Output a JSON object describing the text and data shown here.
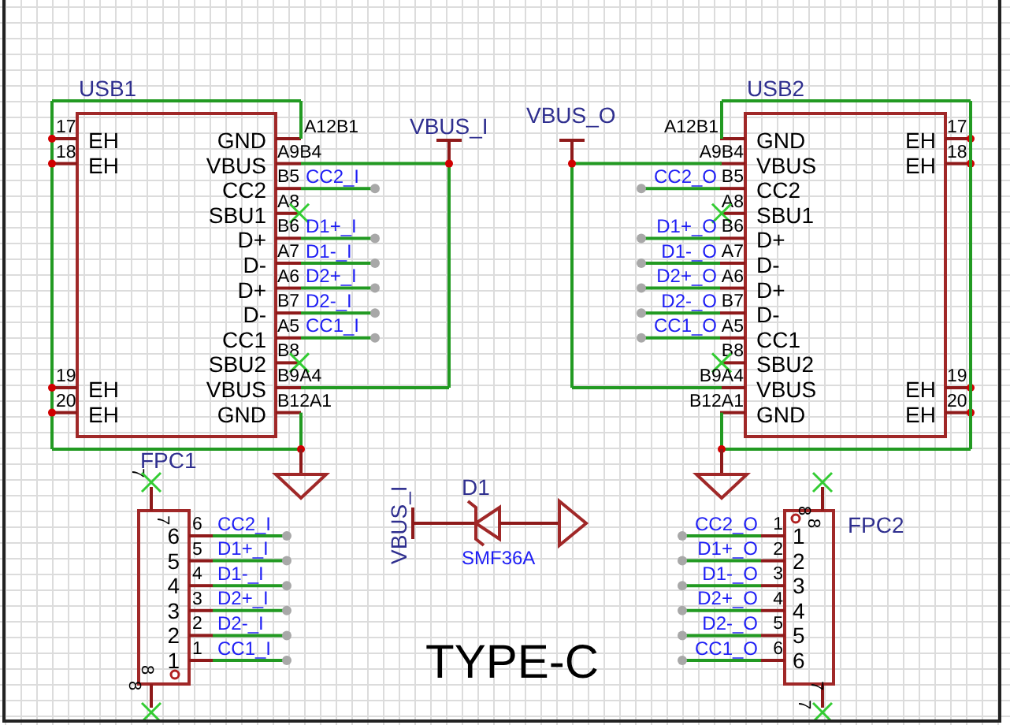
{
  "connectors": [
    {
      "ref": "USB1",
      "left_pins": [
        {
          "number": "17",
          "name": "EH",
          "kind": "pin"
        },
        {
          "number": "18",
          "name": "EH",
          "kind": "pin"
        },
        {
          "number": "19",
          "name": "EH",
          "kind": "pin"
        },
        {
          "number": "20",
          "name": "EH",
          "kind": "pin"
        }
      ],
      "right_pins": [
        {
          "number": "A12B1",
          "name": "GND",
          "kind": "pin"
        },
        {
          "number": "A9B4",
          "name": "VBUS",
          "kind": "pin"
        },
        {
          "number": "B5",
          "name": "CC2",
          "net": "CC2_I",
          "kind": "pin"
        },
        {
          "number": "A8",
          "name": "SBU1",
          "kind": "nc"
        },
        {
          "number": "B6",
          "name": "D+",
          "net": "D1+_I",
          "kind": "pin"
        },
        {
          "number": "A7",
          "name": "D-",
          "net": "D1-_I",
          "kind": "pin"
        },
        {
          "number": "A6",
          "name": "D+",
          "net": "D2+_I",
          "kind": "pin"
        },
        {
          "number": "B7",
          "name": "D-",
          "net": "D2-_I",
          "kind": "pin"
        },
        {
          "number": "A5",
          "name": "CC1",
          "net": "CC1_I",
          "kind": "pin"
        },
        {
          "number": "B8",
          "name": "SBU2",
          "kind": "nc"
        },
        {
          "number": "B9A4",
          "name": "VBUS",
          "kind": "pin"
        },
        {
          "number": "B12A1",
          "name": "GND",
          "kind": "pin"
        }
      ]
    },
    {
      "ref": "USB2",
      "left_pins": [
        {
          "number": "A12B1",
          "name": "GND",
          "kind": "pin"
        },
        {
          "number": "A9B4",
          "name": "VBUS",
          "kind": "pin"
        },
        {
          "number": "B5",
          "name": "CC2",
          "net": "CC2_O",
          "kind": "pin"
        },
        {
          "number": "A8",
          "name": "SBU1",
          "kind": "nc"
        },
        {
          "number": "B6",
          "name": "D+",
          "net": "D1+_O",
          "kind": "pin"
        },
        {
          "number": "A7",
          "name": "D-",
          "net": "D1-_O",
          "kind": "pin"
        },
        {
          "number": "A6",
          "name": "D+",
          "net": "D2+_O",
          "kind": "pin"
        },
        {
          "number": "B7",
          "name": "D-",
          "net": "D2-_O",
          "kind": "pin"
        },
        {
          "number": "A5",
          "name": "CC1",
          "net": "CC1_O",
          "kind": "pin"
        },
        {
          "number": "B8",
          "name": "SBU2",
          "kind": "nc"
        },
        {
          "number": "B9A4",
          "name": "VBUS",
          "kind": "pin"
        },
        {
          "number": "B12A1",
          "name": "GND",
          "kind": "pin"
        }
      ],
      "right_pins": [
        {
          "number": "17",
          "name": "EH",
          "kind": "pin"
        },
        {
          "number": "18",
          "name": "EH",
          "kind": "pin"
        },
        {
          "number": "19",
          "name": "EH",
          "kind": "pin"
        },
        {
          "number": "20",
          "name": "EH",
          "kind": "pin"
        }
      ]
    }
  ],
  "power_ports": [
    {
      "label": "VBUS_I"
    },
    {
      "label": "VBUS_O"
    }
  ],
  "fpc": [
    {
      "ref": "FPC1",
      "top_pin": {
        "number": "7",
        "name": "7",
        "kind": "nc"
      },
      "bottom_pin": {
        "number": "8",
        "name": "8",
        "kind": "nc"
      },
      "side_pins": [
        {
          "number": "6",
          "name": "6",
          "net": "CC2_I"
        },
        {
          "number": "5",
          "name": "5",
          "net": "D1+_I"
        },
        {
          "number": "4",
          "name": "4",
          "net": "D1-_I"
        },
        {
          "number": "3",
          "name": "3",
          "net": "D2+_I"
        },
        {
          "number": "2",
          "name": "2",
          "net": "D2-_I"
        },
        {
          "number": "1",
          "name": "1",
          "net": "CC1_I"
        }
      ]
    },
    {
      "ref": "FPC2",
      "top_pin": {
        "number": "8",
        "name": "8",
        "kind": "nc"
      },
      "bottom_pin": {
        "number": "7",
        "name": "7",
        "kind": "nc"
      },
      "side_pins": [
        {
          "number": "1",
          "name": "1",
          "net": "CC2_O"
        },
        {
          "number": "2",
          "name": "2",
          "net": "D1+_O"
        },
        {
          "number": "3",
          "name": "3",
          "net": "D1-_O"
        },
        {
          "number": "4",
          "name": "4",
          "net": "D2+_O"
        },
        {
          "number": "5",
          "name": "5",
          "net": "D2-_O"
        },
        {
          "number": "6",
          "name": "6",
          "net": "CC1_O"
        }
      ]
    }
  ],
  "diode": {
    "ref": "D1",
    "value": "SMF36A",
    "power_port": "VBUS_I"
  },
  "sheet_title": "TYPE-C"
}
